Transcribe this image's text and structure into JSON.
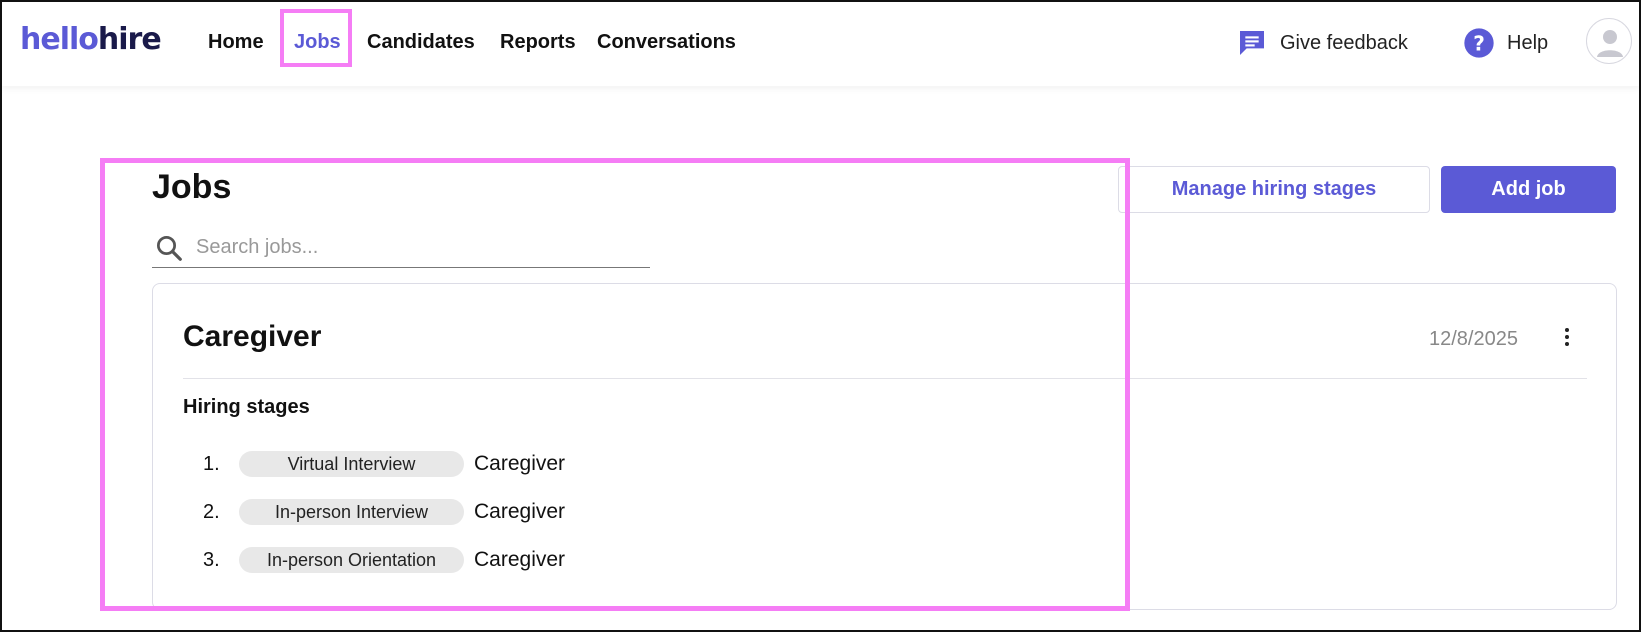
{
  "app": {
    "logo_part1": "hello",
    "logo_part2": "hire"
  },
  "nav": {
    "home": "Home",
    "jobs": "Jobs",
    "candidates": "Candidates",
    "reports": "Reports",
    "conversations": "Conversations",
    "active": "Jobs"
  },
  "header": {
    "feedback": "Give feedback",
    "help": "Help"
  },
  "page": {
    "title": "Jobs",
    "manage_button": "Manage hiring stages",
    "add_button": "Add job",
    "search_placeholder": "Search jobs...",
    "search_value": ""
  },
  "jobs": [
    {
      "title": "Caregiver",
      "date": "12/8/2025",
      "stages_heading": "Hiring stages",
      "stages": [
        {
          "num": "1.",
          "stage": "Virtual Interview",
          "job": "Caregiver"
        },
        {
          "num": "2.",
          "stage": "In-person Interview",
          "job": "Caregiver"
        },
        {
          "num": "3.",
          "stage": "In-person Orientation",
          "job": "Caregiver"
        }
      ]
    }
  ],
  "colors": {
    "accent": "#5b5ad6",
    "highlight": "#f57df5"
  },
  "icons": {
    "feedback": "chat-bubble-icon",
    "help": "question-circle-icon",
    "search": "search-icon",
    "avatar": "user-avatar-icon",
    "menu": "more-vertical-icon"
  }
}
